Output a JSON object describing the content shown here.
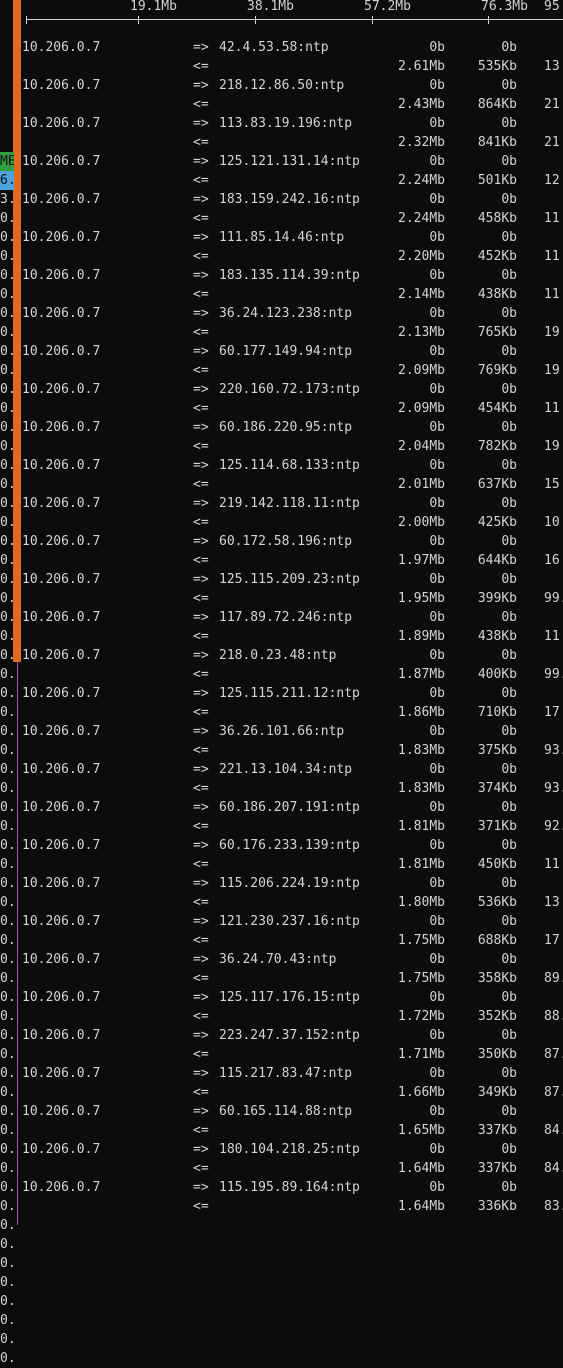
{
  "scale": {
    "ticks": [
      "19.1Mb",
      "38.1Mb",
      "57.2Mb",
      "76.3Mb",
      "95"
    ]
  },
  "left_fragments": [
    {
      "text": "ME",
      "color": "#2ea043"
    },
    {
      "text": "6.",
      "color": "#4aa3df"
    },
    {
      "text": "3."
    },
    {
      "text": "0."
    },
    {
      "text": "0."
    },
    {
      "text": "0."
    },
    {
      "text": "0."
    },
    {
      "text": "0."
    },
    {
      "text": "0."
    },
    {
      "text": "0."
    },
    {
      "text": "0."
    },
    {
      "text": "0."
    },
    {
      "text": "0."
    },
    {
      "text": "0."
    },
    {
      "text": "0."
    },
    {
      "text": "0."
    },
    {
      "text": "0."
    },
    {
      "text": "0."
    },
    {
      "text": "0."
    },
    {
      "text": "0."
    },
    {
      "text": "0."
    },
    {
      "text": "0."
    },
    {
      "text": "0."
    },
    {
      "text": "0."
    },
    {
      "text": "0."
    },
    {
      "text": "0."
    },
    {
      "text": "0."
    },
    {
      "text": "0."
    },
    {
      "text": "0."
    },
    {
      "text": "0."
    },
    {
      "text": "0."
    },
    {
      "text": "0."
    },
    {
      "text": "0."
    },
    {
      "text": "0."
    },
    {
      "text": "0."
    },
    {
      "text": "0."
    },
    {
      "text": "0."
    },
    {
      "text": "0."
    },
    {
      "text": "0."
    },
    {
      "text": "0."
    },
    {
      "text": "0."
    },
    {
      "text": "0."
    },
    {
      "text": "0."
    },
    {
      "text": "0."
    },
    {
      "text": "0."
    },
    {
      "text": "0."
    },
    {
      "text": "0."
    },
    {
      "text": "0."
    },
    {
      "text": "0."
    },
    {
      "text": "0."
    },
    {
      "text": "0."
    },
    {
      "text": "0."
    },
    {
      "text": "0."
    },
    {
      "text": "0."
    },
    {
      "text": "0."
    },
    {
      "text": "0."
    },
    {
      "text": "0."
    },
    {
      "text": "0."
    },
    {
      "text": "0."
    },
    {
      "text": "0."
    },
    {
      "text": "0."
    },
    {
      "text": "0."
    },
    {
      "text": "0."
    },
    {
      "text": "0."
    }
  ],
  "flows": [
    {
      "src": "10.206.0.7",
      "dst": "42.4.53.58:ntp",
      "sent": [
        "0b",
        "0b",
        ""
      ],
      "recv": [
        "2.61Mb",
        "535Kb",
        "13"
      ]
    },
    {
      "src": "10.206.0.7",
      "dst": "218.12.86.50:ntp",
      "sent": [
        "0b",
        "0b",
        ""
      ],
      "recv": [
        "2.43Mb",
        "864Kb",
        "21"
      ]
    },
    {
      "src": "10.206.0.7",
      "dst": "113.83.19.196:ntp",
      "sent": [
        "0b",
        "0b",
        ""
      ],
      "recv": [
        "2.32Mb",
        "841Kb",
        "21"
      ]
    },
    {
      "src": "10.206.0.7",
      "dst": "125.121.131.14:ntp",
      "sent": [
        "0b",
        "0b",
        ""
      ],
      "recv": [
        "2.24Mb",
        "501Kb",
        "12"
      ]
    },
    {
      "src": "10.206.0.7",
      "dst": "183.159.242.16:ntp",
      "sent": [
        "0b",
        "0b",
        ""
      ],
      "recv": [
        "2.24Mb",
        "458Kb",
        "11"
      ]
    },
    {
      "src": "10.206.0.7",
      "dst": "111.85.14.46:ntp",
      "sent": [
        "0b",
        "0b",
        ""
      ],
      "recv": [
        "2.20Mb",
        "452Kb",
        "11"
      ]
    },
    {
      "src": "10.206.0.7",
      "dst": "183.135.114.39:ntp",
      "sent": [
        "0b",
        "0b",
        ""
      ],
      "recv": [
        "2.14Mb",
        "438Kb",
        "11"
      ]
    },
    {
      "src": "10.206.0.7",
      "dst": "36.24.123.238:ntp",
      "sent": [
        "0b",
        "0b",
        ""
      ],
      "recv": [
        "2.13Mb",
        "765Kb",
        "19"
      ]
    },
    {
      "src": "10.206.0.7",
      "dst": "60.177.149.94:ntp",
      "sent": [
        "0b",
        "0b",
        ""
      ],
      "recv": [
        "2.09Mb",
        "769Kb",
        "19"
      ]
    },
    {
      "src": "10.206.0.7",
      "dst": "220.160.72.173:ntp",
      "sent": [
        "0b",
        "0b",
        ""
      ],
      "recv": [
        "2.09Mb",
        "454Kb",
        "11"
      ]
    },
    {
      "src": "10.206.0.7",
      "dst": "60.186.220.95:ntp",
      "sent": [
        "0b",
        "0b",
        ""
      ],
      "recv": [
        "2.04Mb",
        "782Kb",
        "19"
      ]
    },
    {
      "src": "10.206.0.7",
      "dst": "125.114.68.133:ntp",
      "sent": [
        "0b",
        "0b",
        ""
      ],
      "recv": [
        "2.01Mb",
        "637Kb",
        "15"
      ]
    },
    {
      "src": "10.206.0.7",
      "dst": "219.142.118.11:ntp",
      "sent": [
        "0b",
        "0b",
        ""
      ],
      "recv": [
        "2.00Mb",
        "425Kb",
        "10"
      ]
    },
    {
      "src": "10.206.0.7",
      "dst": "60.172.58.196:ntp",
      "sent": [
        "0b",
        "0b",
        ""
      ],
      "recv": [
        "1.97Mb",
        "644Kb",
        "16"
      ]
    },
    {
      "src": "10.206.0.7",
      "dst": "125.115.209.23:ntp",
      "sent": [
        "0b",
        "0b",
        ""
      ],
      "recv": [
        "1.95Mb",
        "399Kb",
        "99."
      ]
    },
    {
      "src": "10.206.0.7",
      "dst": "117.89.72.246:ntp",
      "sent": [
        "0b",
        "0b",
        ""
      ],
      "recv": [
        "1.89Mb",
        "438Kb",
        "11"
      ]
    },
    {
      "src": "10.206.0.7",
      "dst": "218.0.23.48:ntp",
      "sent": [
        "0b",
        "0b",
        ""
      ],
      "recv": [
        "1.87Mb",
        "400Kb",
        "99."
      ]
    },
    {
      "src": "10.206.0.7",
      "dst": "125.115.211.12:ntp",
      "sent": [
        "0b",
        "0b",
        ""
      ],
      "recv": [
        "1.86Mb",
        "710Kb",
        "17"
      ]
    },
    {
      "src": "10.206.0.7",
      "dst": "36.26.101.66:ntp",
      "sent": [
        "0b",
        "0b",
        ""
      ],
      "recv": [
        "1.83Mb",
        "375Kb",
        "93."
      ]
    },
    {
      "src": "10.206.0.7",
      "dst": "221.13.104.34:ntp",
      "sent": [
        "0b",
        "0b",
        ""
      ],
      "recv": [
        "1.83Mb",
        "374Kb",
        "93."
      ]
    },
    {
      "src": "10.206.0.7",
      "dst": "60.186.207.191:ntp",
      "sent": [
        "0b",
        "0b",
        ""
      ],
      "recv": [
        "1.81Mb",
        "371Kb",
        "92."
      ]
    },
    {
      "src": "10.206.0.7",
      "dst": "60.176.233.139:ntp",
      "sent": [
        "0b",
        "0b",
        ""
      ],
      "recv": [
        "1.81Mb",
        "450Kb",
        "11"
      ]
    },
    {
      "src": "10.206.0.7",
      "dst": "115.206.224.19:ntp",
      "sent": [
        "0b",
        "0b",
        ""
      ],
      "recv": [
        "1.80Mb",
        "536Kb",
        "13"
      ]
    },
    {
      "src": "10.206.0.7",
      "dst": "121.230.237.16:ntp",
      "sent": [
        "0b",
        "0b",
        ""
      ],
      "recv": [
        "1.75Mb",
        "688Kb",
        "17"
      ]
    },
    {
      "src": "10.206.0.7",
      "dst": "36.24.70.43:ntp",
      "sent": [
        "0b",
        "0b",
        ""
      ],
      "recv": [
        "1.75Mb",
        "358Kb",
        "89."
      ]
    },
    {
      "src": "10.206.0.7",
      "dst": "125.117.176.15:ntp",
      "sent": [
        "0b",
        "0b",
        ""
      ],
      "recv": [
        "1.72Mb",
        "352Kb",
        "88."
      ]
    },
    {
      "src": "10.206.0.7",
      "dst": "223.247.37.152:ntp",
      "sent": [
        "0b",
        "0b",
        ""
      ],
      "recv": [
        "1.71Mb",
        "350Kb",
        "87."
      ]
    },
    {
      "src": "10.206.0.7",
      "dst": "115.217.83.47:ntp",
      "sent": [
        "0b",
        "0b",
        ""
      ],
      "recv": [
        "1.66Mb",
        "349Kb",
        "87."
      ]
    },
    {
      "src": "10.206.0.7",
      "dst": "60.165.114.88:ntp",
      "sent": [
        "0b",
        "0b",
        ""
      ],
      "recv": [
        "1.65Mb",
        "337Kb",
        "84."
      ]
    },
    {
      "src": "10.206.0.7",
      "dst": "180.104.218.25:ntp",
      "sent": [
        "0b",
        "0b",
        ""
      ],
      "recv": [
        "1.64Mb",
        "337Kb",
        "84."
      ]
    },
    {
      "src": "10.206.0.7",
      "dst": "115.195.89.164:ntp",
      "sent": [
        "0b",
        "0b",
        ""
      ],
      "recv": [
        "1.64Mb",
        "336Kb",
        "83."
      ]
    }
  ],
  "arrows": {
    "out": "=>",
    "in": "<="
  },
  "colors": {
    "background": "#0c0c0c",
    "text": "#d4d4d4",
    "bar": "#e06c1a",
    "divider": "#9b59b6"
  }
}
